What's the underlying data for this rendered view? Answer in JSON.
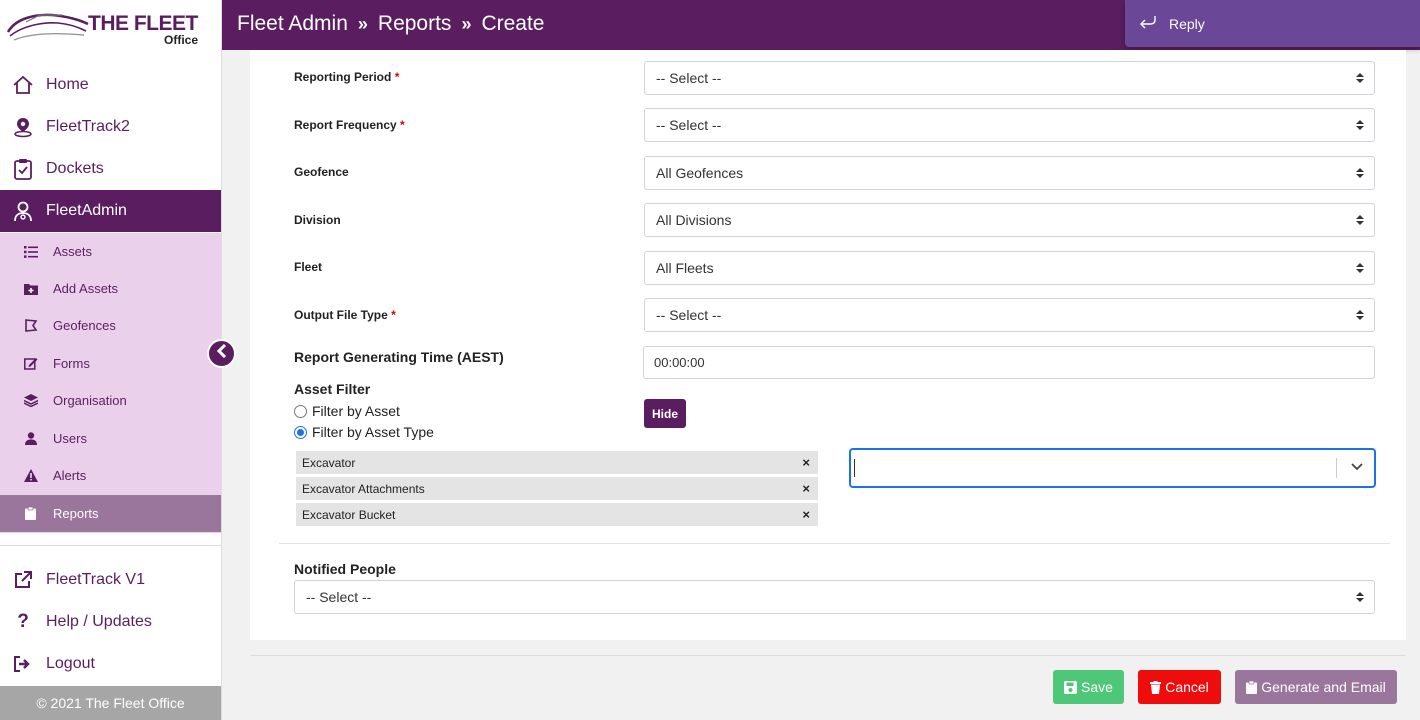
{
  "brand": {
    "name": "THE FLEET",
    "sub": "Office"
  },
  "header": {
    "breadcrumb": [
      "Fleet Admin",
      "Reports",
      "Create"
    ],
    "separator": "»",
    "reply_label": "Reply"
  },
  "sidebar": {
    "main_items": [
      {
        "label": "Home",
        "icon": "home-icon"
      },
      {
        "label": "FleetTrack2",
        "icon": "map-pin-icon"
      },
      {
        "label": "Dockets",
        "icon": "clipboard-check-icon"
      },
      {
        "label": "FleetAdmin",
        "icon": "user-admin-icon",
        "active": true
      }
    ],
    "sub_items": [
      {
        "label": "Assets",
        "icon": "list-icon"
      },
      {
        "label": "Add Assets",
        "icon": "folder-plus-icon"
      },
      {
        "label": "Geofences",
        "icon": "map-area-icon"
      },
      {
        "label": "Forms",
        "icon": "edit-icon"
      },
      {
        "label": "Organisation",
        "icon": "layers-icon"
      },
      {
        "label": "Users",
        "icon": "user-icon"
      },
      {
        "label": "Alerts",
        "icon": "warning-icon"
      },
      {
        "label": "Reports",
        "icon": "clipboard-icon",
        "active": true
      }
    ],
    "bottom_items": [
      {
        "label": "FleetTrack V1",
        "icon": "external-link-icon"
      },
      {
        "label": "Help / Updates",
        "icon": "question-icon"
      },
      {
        "label": "Logout",
        "icon": "logout-icon"
      }
    ],
    "footer": "© 2021 The Fleet Office"
  },
  "form": {
    "reporting_period": {
      "label": "Reporting Period",
      "required": "*",
      "value": "-- Select --"
    },
    "report_frequency": {
      "label": "Report Frequency",
      "required": "*",
      "value": "-- Select --"
    },
    "geofence": {
      "label": "Geofence",
      "value": "All Geofences"
    },
    "division": {
      "label": "Division",
      "value": "All Divisions"
    },
    "fleet": {
      "label": "Fleet",
      "value": "All Fleets"
    },
    "output_file_type": {
      "label": "Output File Type",
      "required": "*",
      "value": "-- Select --"
    },
    "report_time": {
      "label": "Report Generating Time (AEST)",
      "value": "00:00:00"
    },
    "asset_filter": {
      "label": "Asset Filter",
      "option_asset": "Filter by Asset",
      "option_asset_type": "Filter by Asset Type",
      "selected": "asset_type",
      "hide_label": "Hide",
      "chips": [
        "Excavator",
        "Excavator Attachments",
        "Excavator Bucket"
      ],
      "remove_label": "×"
    },
    "notified_people": {
      "label": "Notified People",
      "value": "-- Select --"
    }
  },
  "actions": {
    "save": "Save",
    "cancel": "Cancel",
    "generate": "Generate and Email"
  },
  "colors": {
    "brand_purple": "#5a1e60",
    "submenu_bg": "#ebd0ec",
    "active_sub": "#9a759c",
    "reply_bg": "#6a4797",
    "save_green": "#4fc779",
    "cancel_red": "#ee0c0c",
    "focus_blue": "#1a73e8"
  }
}
